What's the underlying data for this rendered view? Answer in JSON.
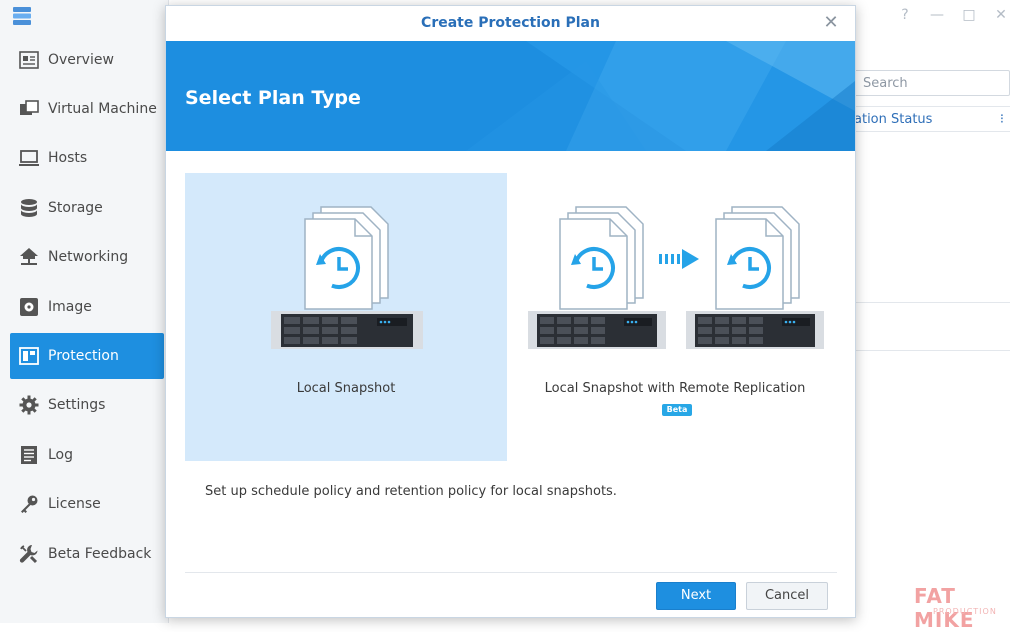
{
  "sidebar": {
    "items": [
      {
        "label": "Overview",
        "icon": "overview-icon",
        "active": false
      },
      {
        "label": "Virtual Machine",
        "icon": "virtual-machine-icon",
        "active": false
      },
      {
        "label": "Hosts",
        "icon": "hosts-icon",
        "active": false
      },
      {
        "label": "Storage",
        "icon": "storage-icon",
        "active": false
      },
      {
        "label": "Networking",
        "icon": "networking-icon",
        "active": false
      },
      {
        "label": "Image",
        "icon": "image-icon",
        "active": false
      },
      {
        "label": "Protection",
        "icon": "protection-icon",
        "active": true
      },
      {
        "label": "Settings",
        "icon": "gear-icon",
        "active": false
      },
      {
        "label": "Log",
        "icon": "log-icon",
        "active": false
      },
      {
        "label": "License",
        "icon": "key-icon",
        "active": false
      },
      {
        "label": "Beta Feedback",
        "icon": "wrench-icon",
        "active": false
      }
    ]
  },
  "background": {
    "search_placeholder": "Search",
    "column_header": "ation Status",
    "window_controls": [
      "?",
      "—",
      "□",
      "✕"
    ]
  },
  "modal": {
    "title": "Create Protection Plan",
    "banner_title": "Select Plan Type",
    "options": [
      {
        "label": "Local Snapshot",
        "selected": true
      },
      {
        "label": "Local Snapshot with Remote Replication",
        "badge": "Beta",
        "selected": false
      }
    ],
    "description": "Set up schedule policy and retention policy for local snapshots.",
    "next_label": "Next",
    "cancel_label": "Cancel"
  },
  "watermark": {
    "line1": "FAT MIKE",
    "line2": "PRODUCTION"
  },
  "colors": {
    "accent": "#1e8fe0",
    "selected_bg": "#d4e9fb",
    "title": "#2a6fb8",
    "beta": "#28a7e6"
  }
}
